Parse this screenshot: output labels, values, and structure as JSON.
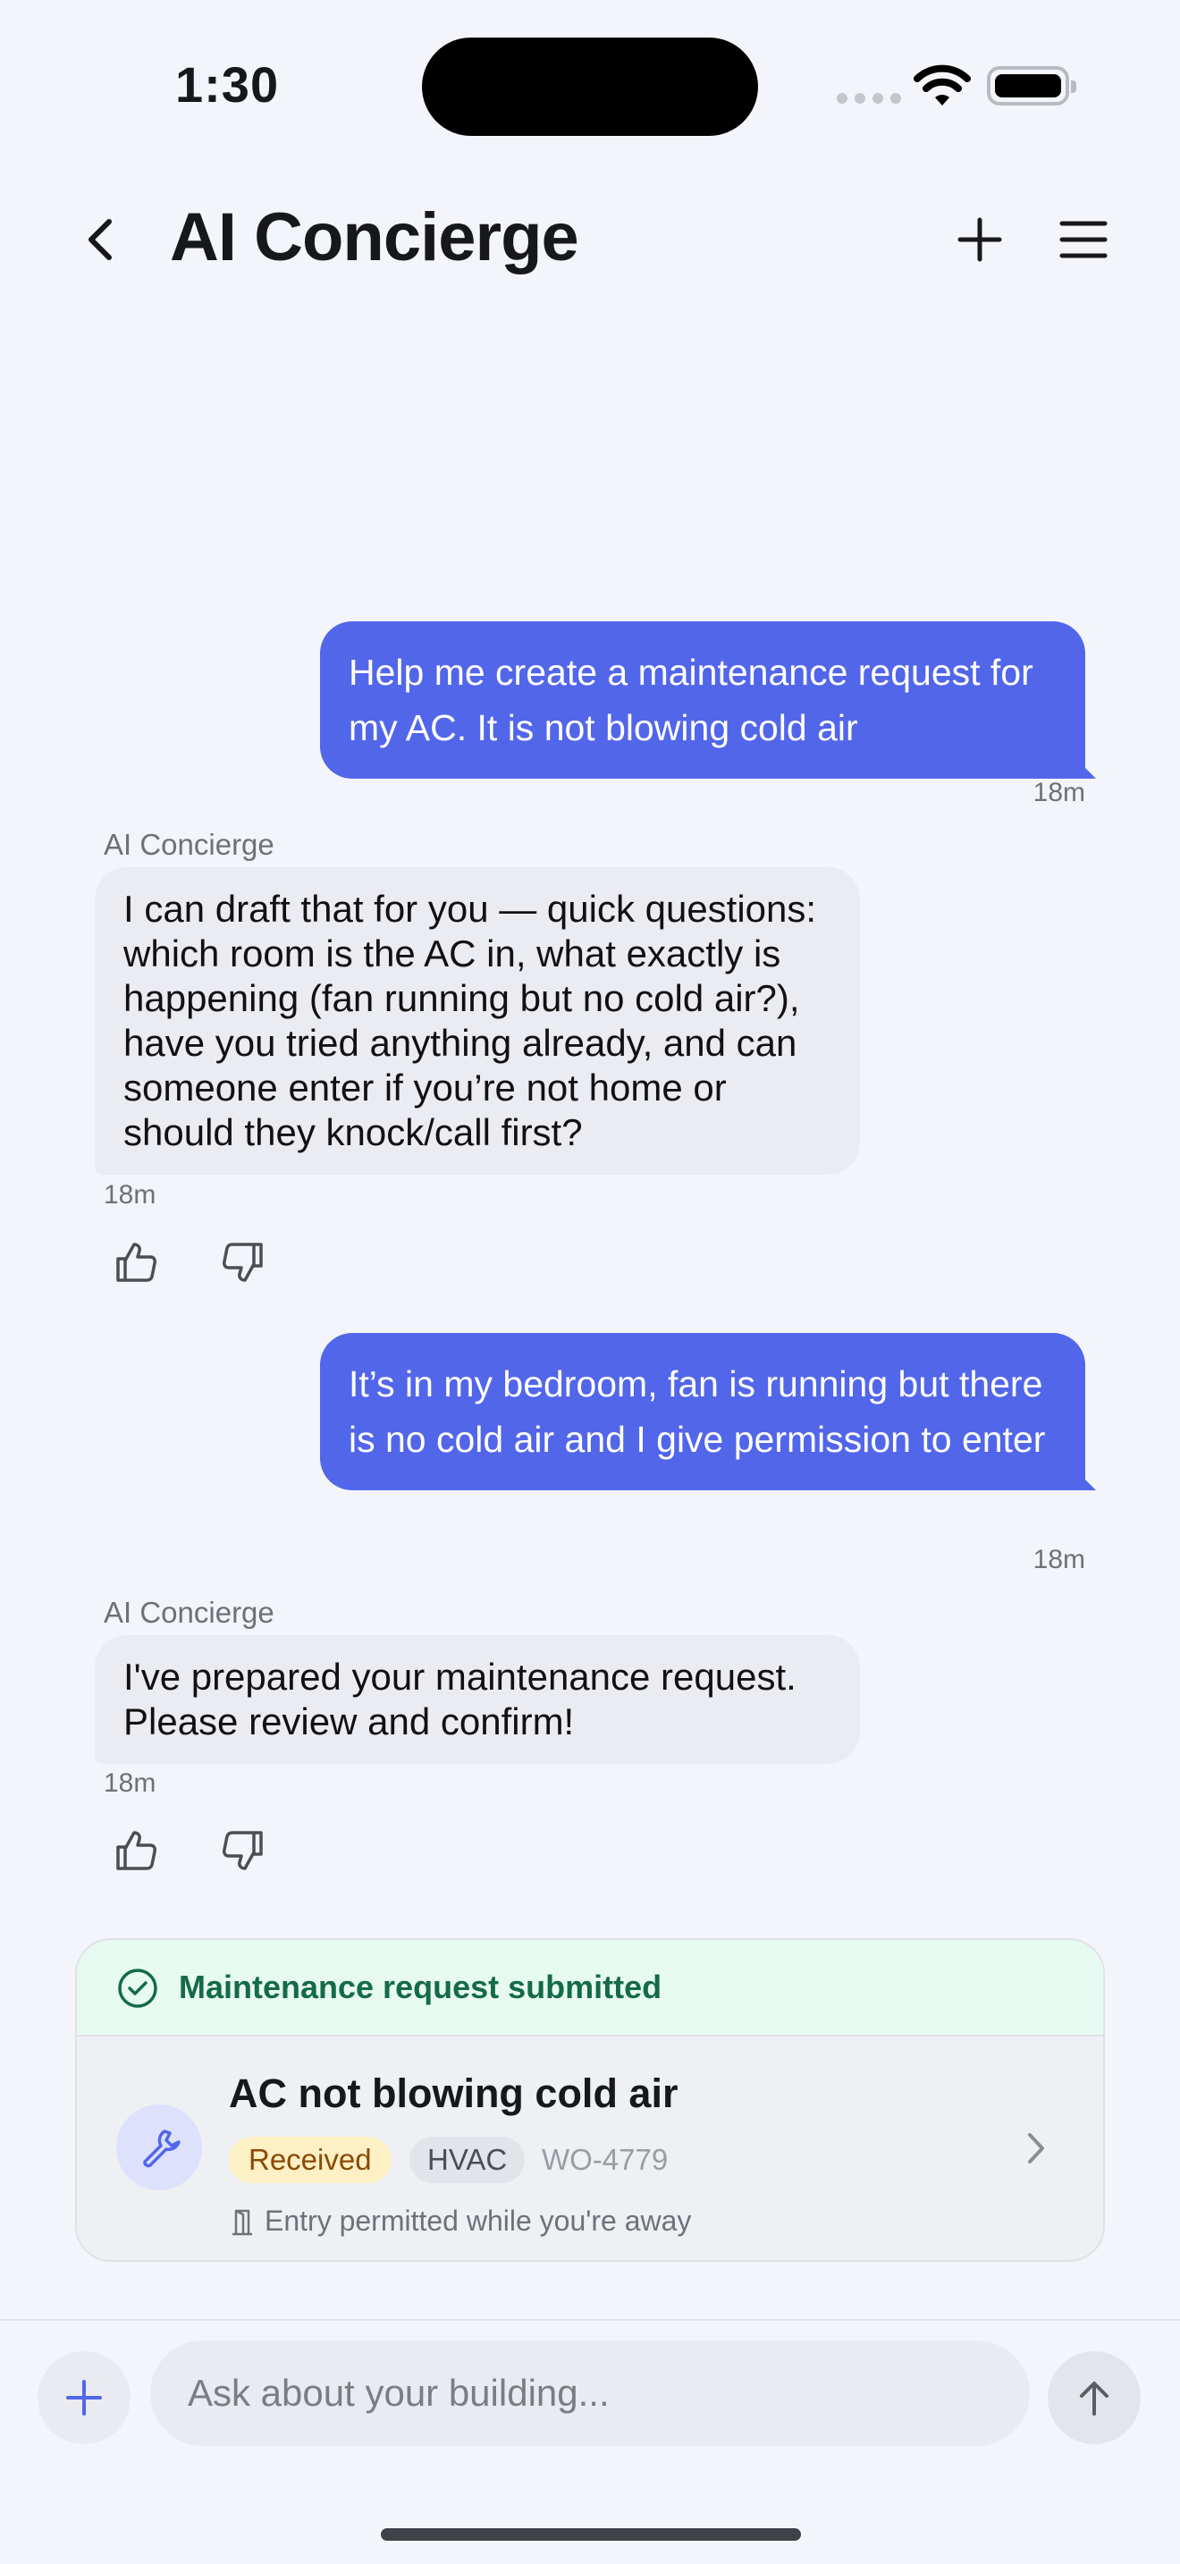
{
  "status_bar": {
    "time": "1:30"
  },
  "header": {
    "title": "AI Concierge"
  },
  "messages": [
    {
      "role": "user",
      "text": "Help me create a maintenance request for my AC. It is not blowing cold air",
      "time": "18m"
    },
    {
      "role": "assistant",
      "sender": "AI Concierge",
      "text": "I can draft that for you — quick questions: which room is the AC in, what exactly is happening (fan running but no cold air?), have you tried anything already, and can someone enter if you’re not home or should they knock/call first?",
      "time": "18m"
    },
    {
      "role": "user",
      "text": "It’s in my bedroom, fan is running but there is no cold air and I give permission to enter",
      "time": "18m"
    },
    {
      "role": "assistant",
      "sender": "AI Concierge",
      "text": "I've prepared your maintenance request. Please review and confirm!",
      "time": "18m"
    }
  ],
  "request_card": {
    "banner": "Maintenance request submitted",
    "title": "AC not blowing cold air",
    "status": "Received",
    "category": "HVAC",
    "work_order": "WO-4779",
    "entry_note": "Entry permitted while you're away"
  },
  "composer": {
    "placeholder": "Ask about your building..."
  },
  "colors": {
    "accent": "#5266ea",
    "success": "#146b46",
    "received_pill": "#fdf0c4"
  }
}
